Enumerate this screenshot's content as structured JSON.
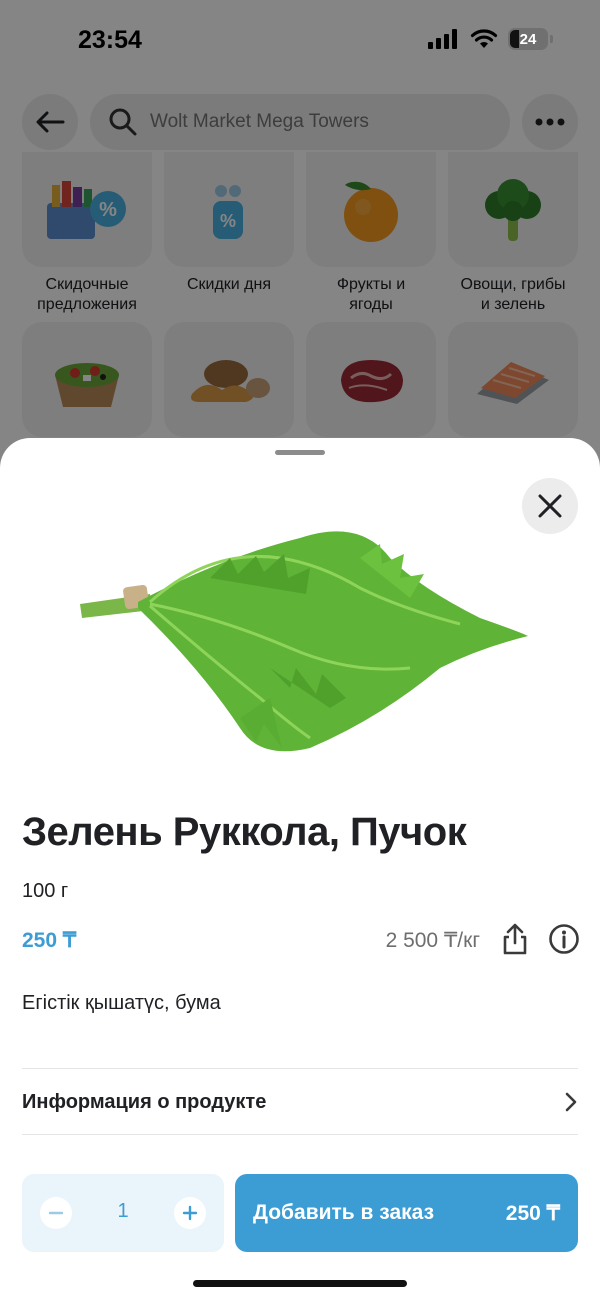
{
  "status_bar": {
    "time": "23:54",
    "battery": "24"
  },
  "search": {
    "placeholder": "Wolt Market Mega Towers"
  },
  "categories": [
    {
      "label": "Скидочные\nпредложения",
      "icon": "discount-basket-icon"
    },
    {
      "label": "Скидки дня",
      "icon": "daily-discount-icon"
    },
    {
      "label": "Фрукты и\nягоды",
      "icon": "orange-icon"
    },
    {
      "label": "Овощи, грибы\nи зелень",
      "icon": "broccoli-icon"
    },
    {
      "label": "",
      "icon": "salad-bowl-icon"
    },
    {
      "label": "",
      "icon": "bread-icon"
    },
    {
      "label": "",
      "icon": "meat-icon"
    },
    {
      "label": "",
      "icon": "fish-icon"
    }
  ],
  "product": {
    "title": "Зелень Руккола, Пучок",
    "weight": "100 г",
    "price": "250 ₸",
    "unit_price": "2 500 ₸/кг",
    "description": "Егістік қышатүс, бума",
    "info_label": "Информация о продукте"
  },
  "cart": {
    "quantity": "1",
    "add_label": "Добавить в заказ",
    "add_price": "250 ₸"
  },
  "colors": {
    "accent": "#3c9cd4",
    "accent_light": "#eaf4fb",
    "text": "#202125"
  }
}
